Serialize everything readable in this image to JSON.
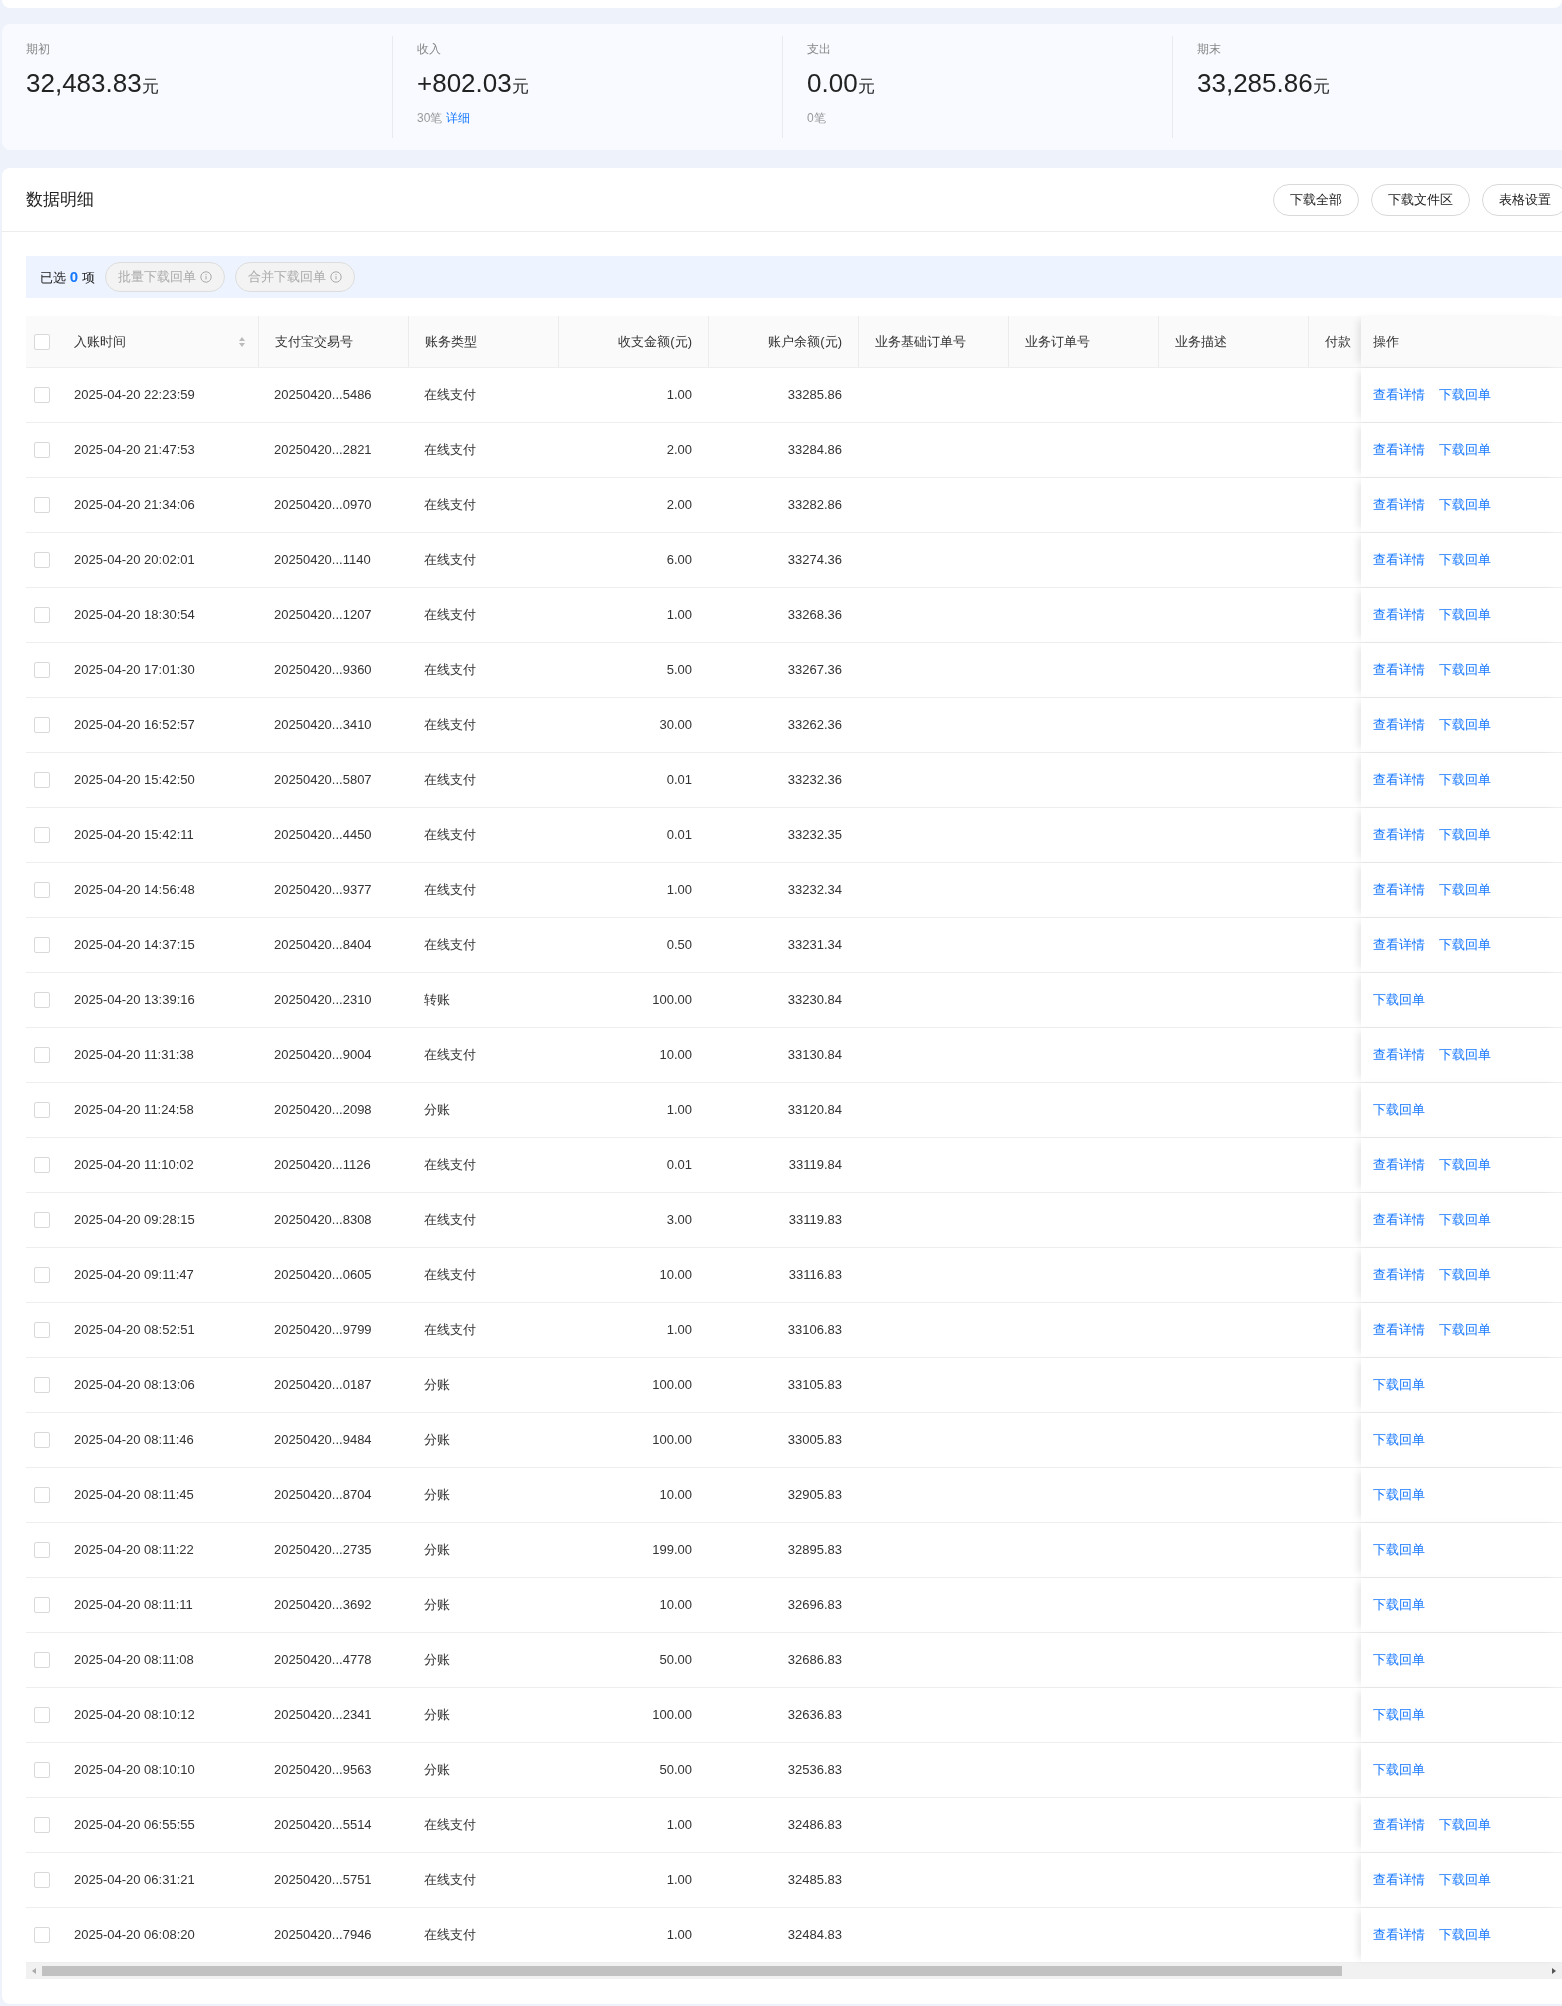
{
  "summary": [
    {
      "label": "期初",
      "value": "32,483.83",
      "unit": "元"
    },
    {
      "label": "收入",
      "value": "+802.03",
      "unit": "元",
      "count": "30笔",
      "link": "详细"
    },
    {
      "label": "支出",
      "value": "0.00",
      "unit": "元",
      "count": "0笔"
    },
    {
      "label": "期末",
      "value": "33,285.86",
      "unit": "元"
    }
  ],
  "detail": {
    "title": "数据明细",
    "buttons": [
      "下载全部",
      "下载文件区",
      "表格设置"
    ]
  },
  "selection": {
    "prefix": "已选",
    "count": "0",
    "suffix": "项",
    "buttons": [
      {
        "label": "批量下载回单",
        "disabled": true
      },
      {
        "label": "合并下载回单",
        "disabled": true
      }
    ]
  },
  "table": {
    "select_all": {
      "checked": false
    },
    "columns": [
      {
        "label": "入账时间",
        "sortable": true,
        "kind": "text"
      },
      {
        "label": "支付宝交易号",
        "sortable": false,
        "kind": "text"
      },
      {
        "label": "账务类型",
        "sortable": false,
        "kind": "text"
      },
      {
        "label": "收支金额(元)",
        "sortable": false,
        "kind": "amount"
      },
      {
        "label": "账户余额(元)",
        "sortable": false,
        "kind": "amount"
      },
      {
        "label": "业务基础订单号",
        "sortable": false,
        "kind": "text"
      },
      {
        "label": "业务订单号",
        "sortable": false,
        "kind": "text"
      },
      {
        "label": "业务描述",
        "sortable": false,
        "kind": "text"
      },
      {
        "label": "付款",
        "sortable": false,
        "kind": "text"
      }
    ],
    "action_column": "操作",
    "rows": [
      {
        "checked": false,
        "cells": [
          "2025-04-20 22:23:59",
          "20250420...5486",
          "在线支付",
          "1.00",
          "33285.86"
        ],
        "actions": [
          "查看详情",
          "下载回单"
        ]
      },
      {
        "checked": false,
        "cells": [
          "2025-04-20 21:47:53",
          "20250420...2821",
          "在线支付",
          "2.00",
          "33284.86"
        ],
        "actions": [
          "查看详情",
          "下载回单"
        ]
      },
      {
        "checked": false,
        "cells": [
          "2025-04-20 21:34:06",
          "20250420...0970",
          "在线支付",
          "2.00",
          "33282.86"
        ],
        "actions": [
          "查看详情",
          "下载回单"
        ]
      },
      {
        "checked": false,
        "cells": [
          "2025-04-20 20:02:01",
          "20250420...1140",
          "在线支付",
          "6.00",
          "33274.36"
        ],
        "actions": [
          "查看详情",
          "下载回单"
        ]
      },
      {
        "checked": false,
        "cells": [
          "2025-04-20 18:30:54",
          "20250420...1207",
          "在线支付",
          "1.00",
          "33268.36"
        ],
        "actions": [
          "查看详情",
          "下载回单"
        ]
      },
      {
        "checked": false,
        "cells": [
          "2025-04-20 17:01:30",
          "20250420...9360",
          "在线支付",
          "5.00",
          "33267.36"
        ],
        "actions": [
          "查看详情",
          "下载回单"
        ]
      },
      {
        "checked": false,
        "cells": [
          "2025-04-20 16:52:57",
          "20250420...3410",
          "在线支付",
          "30.00",
          "33262.36"
        ],
        "actions": [
          "查看详情",
          "下载回单"
        ]
      },
      {
        "checked": false,
        "cells": [
          "2025-04-20 15:42:50",
          "20250420...5807",
          "在线支付",
          "0.01",
          "33232.36"
        ],
        "actions": [
          "查看详情",
          "下载回单"
        ]
      },
      {
        "checked": false,
        "cells": [
          "2025-04-20 15:42:11",
          "20250420...4450",
          "在线支付",
          "0.01",
          "33232.35"
        ],
        "actions": [
          "查看详情",
          "下载回单"
        ]
      },
      {
        "checked": false,
        "cells": [
          "2025-04-20 14:56:48",
          "20250420...9377",
          "在线支付",
          "1.00",
          "33232.34"
        ],
        "actions": [
          "查看详情",
          "下载回单"
        ]
      },
      {
        "checked": false,
        "cells": [
          "2025-04-20 14:37:15",
          "20250420...8404",
          "在线支付",
          "0.50",
          "33231.34"
        ],
        "actions": [
          "查看详情",
          "下载回单"
        ]
      },
      {
        "checked": false,
        "cells": [
          "2025-04-20 13:39:16",
          "20250420...2310",
          "转账",
          "100.00",
          "33230.84"
        ],
        "actions": [
          "下载回单"
        ]
      },
      {
        "checked": false,
        "cells": [
          "2025-04-20 11:31:38",
          "20250420...9004",
          "在线支付",
          "10.00",
          "33130.84"
        ],
        "actions": [
          "查看详情",
          "下载回单"
        ]
      },
      {
        "checked": false,
        "cells": [
          "2025-04-20 11:24:58",
          "20250420...2098",
          "分账",
          "1.00",
          "33120.84"
        ],
        "actions": [
          "下载回单"
        ]
      },
      {
        "checked": false,
        "cells": [
          "2025-04-20 11:10:02",
          "20250420...1126",
          "在线支付",
          "0.01",
          "33119.84"
        ],
        "actions": [
          "查看详情",
          "下载回单"
        ]
      },
      {
        "checked": false,
        "cells": [
          "2025-04-20 09:28:15",
          "20250420...8308",
          "在线支付",
          "3.00",
          "33119.83"
        ],
        "actions": [
          "查看详情",
          "下载回单"
        ]
      },
      {
        "checked": false,
        "cells": [
          "2025-04-20 09:11:47",
          "20250420...0605",
          "在线支付",
          "10.00",
          "33116.83"
        ],
        "actions": [
          "查看详情",
          "下载回单"
        ]
      },
      {
        "checked": false,
        "cells": [
          "2025-04-20 08:52:51",
          "20250420...9799",
          "在线支付",
          "1.00",
          "33106.83"
        ],
        "actions": [
          "查看详情",
          "下载回单"
        ]
      },
      {
        "checked": false,
        "cells": [
          "2025-04-20 08:13:06",
          "20250420...0187",
          "分账",
          "100.00",
          "33105.83"
        ],
        "actions": [
          "下载回单"
        ]
      },
      {
        "checked": false,
        "cells": [
          "2025-04-20 08:11:46",
          "20250420...9484",
          "分账",
          "100.00",
          "33005.83"
        ],
        "actions": [
          "下载回单"
        ]
      },
      {
        "checked": false,
        "cells": [
          "2025-04-20 08:11:45",
          "20250420...8704",
          "分账",
          "10.00",
          "32905.83"
        ],
        "actions": [
          "下载回单"
        ]
      },
      {
        "checked": false,
        "cells": [
          "2025-04-20 08:11:22",
          "20250420...2735",
          "分账",
          "199.00",
          "32895.83"
        ],
        "actions": [
          "下载回单"
        ]
      },
      {
        "checked": false,
        "cells": [
          "2025-04-20 08:11:11",
          "20250420...3692",
          "分账",
          "10.00",
          "32696.83"
        ],
        "actions": [
          "下载回单"
        ]
      },
      {
        "checked": false,
        "cells": [
          "2025-04-20 08:11:08",
          "20250420...4778",
          "分账",
          "50.00",
          "32686.83"
        ],
        "actions": [
          "下载回单"
        ]
      },
      {
        "checked": false,
        "cells": [
          "2025-04-20 08:10:12",
          "20250420...2341",
          "分账",
          "100.00",
          "32636.83"
        ],
        "actions": [
          "下载回单"
        ]
      },
      {
        "checked": false,
        "cells": [
          "2025-04-20 08:10:10",
          "20250420...9563",
          "分账",
          "50.00",
          "32536.83"
        ],
        "actions": [
          "下载回单"
        ]
      },
      {
        "checked": false,
        "cells": [
          "2025-04-20 06:55:55",
          "20250420...5514",
          "在线支付",
          "1.00",
          "32486.83"
        ],
        "actions": [
          "查看详情",
          "下载回单"
        ]
      },
      {
        "checked": false,
        "cells": [
          "2025-04-20 06:31:21",
          "20250420...5751",
          "在线支付",
          "1.00",
          "32485.83"
        ],
        "actions": [
          "查看详情",
          "下载回单"
        ]
      },
      {
        "checked": false,
        "cells": [
          "2025-04-20 06:08:20",
          "20250420...7946",
          "在线支付",
          "1.00",
          "32484.83"
        ],
        "actions": [
          "查看详情",
          "下载回单"
        ]
      }
    ]
  }
}
